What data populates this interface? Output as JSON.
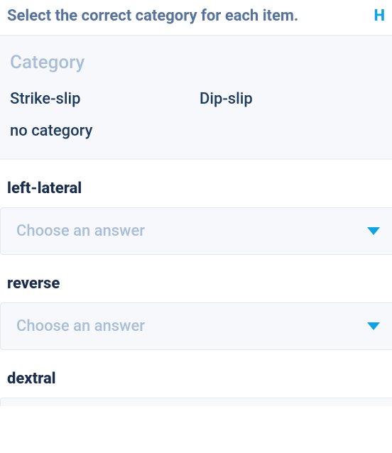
{
  "topbar": {
    "instruction": "Select the correct category for each item.",
    "hint_label": "H"
  },
  "category_panel": {
    "heading": "Category",
    "categories": [
      "Strike-slip",
      "Dip-slip",
      "no category"
    ]
  },
  "select_placeholder": "Choose an answer",
  "items": [
    {
      "label": "left-lateral"
    },
    {
      "label": "reverse"
    },
    {
      "label": "dextral"
    }
  ]
}
